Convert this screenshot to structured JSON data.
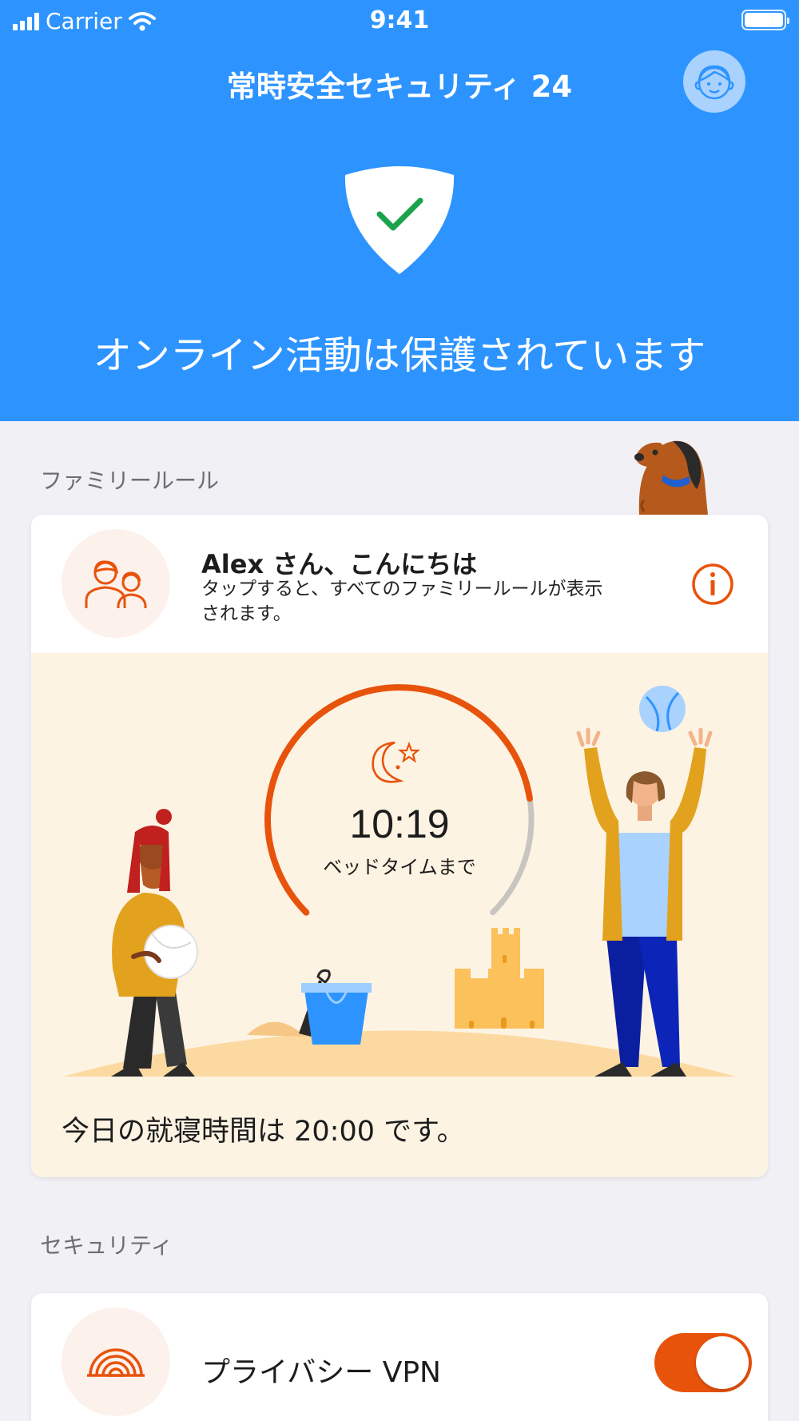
{
  "status_bar": {
    "carrier": "Carrier",
    "time": "9:41"
  },
  "header": {
    "title": "常時安全セキュリティ 24"
  },
  "hero": {
    "status_text": "オンライン活動は保護されています"
  },
  "family_section": {
    "label": "ファミリールール",
    "greeting": "Alex さん、こんにちは",
    "subtitle": "タップすると、すべてのファミリールールが表示されます。",
    "countdown": "10:19",
    "countdown_label": "ベッドタイムまで",
    "countdown_progress": 0.8,
    "bedtime_note": "今日の就寝時間は 20:00 です。"
  },
  "security_section": {
    "label": "セキュリティ",
    "vpn_label": "プライバシー VPN",
    "vpn_enabled": true
  },
  "colors": {
    "brand_blue": "#2d94ff",
    "accent_orange": "#e8530c",
    "scene_background": "#fdf3e3",
    "shield_check": "#1aa34a"
  }
}
